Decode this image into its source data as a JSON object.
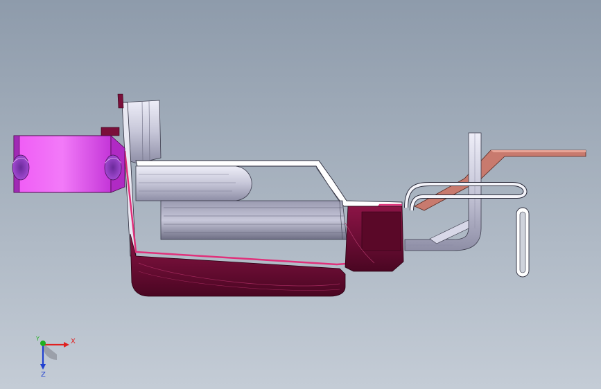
{
  "viewport": {
    "background_top": "#8e9bab",
    "background_bottom": "#c4ccd6"
  },
  "triad": {
    "x_label": "X",
    "y_label": "Y",
    "z_label": "Z",
    "x_color": "#e02020",
    "y_color": "#20b020",
    "z_color": "#2040d0"
  },
  "model": {
    "parts": [
      "mounting-bracket",
      "main-fixture-frame",
      "wire-form-clip",
      "copper-strip",
      "support-cradle"
    ],
    "colors": {
      "bracket": "#e63cf0",
      "frame": "#c8c8dc",
      "cradle": "#7a0f3a",
      "strip": "#c87a6e"
    }
  }
}
